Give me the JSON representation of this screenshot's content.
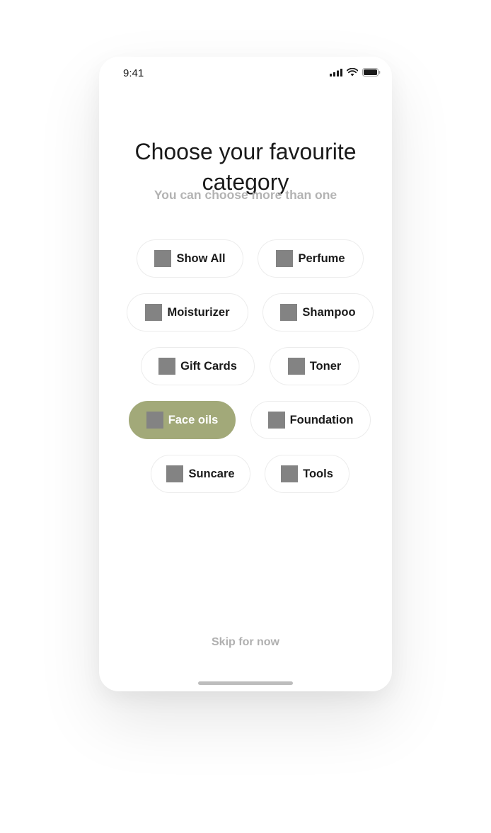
{
  "status_bar": {
    "time": "9:41",
    "icons": [
      "signal-icon",
      "wifi-icon",
      "battery-icon"
    ]
  },
  "header": {
    "title": "Choose your favourite category",
    "subtitle": "You can choose more than one"
  },
  "categories": [
    {
      "label": "Show All",
      "selected": false,
      "icon": "category-icon"
    },
    {
      "label": "Perfume",
      "selected": false,
      "icon": "category-icon"
    },
    {
      "label": "Moisturizer",
      "selected": false,
      "icon": "category-icon"
    },
    {
      "label": "Shampoo",
      "selected": false,
      "icon": "category-icon"
    },
    {
      "label": "Gift Cards",
      "selected": false,
      "icon": "category-icon"
    },
    {
      "label": "Toner",
      "selected": false,
      "icon": "category-icon"
    },
    {
      "label": "Face oils",
      "selected": true,
      "icon": "category-icon"
    },
    {
      "label": "Foundation",
      "selected": false,
      "icon": "category-icon"
    },
    {
      "label": "Suncare",
      "selected": false,
      "icon": "category-icon"
    },
    {
      "label": "Tools",
      "selected": false,
      "icon": "category-icon"
    }
  ],
  "footer": {
    "skip_label": "Skip for now"
  },
  "colors": {
    "accent": "#a2a979",
    "icon_placeholder": "#838383",
    "muted_text": "#b3b3b3",
    "text": "#1a1a1a"
  }
}
